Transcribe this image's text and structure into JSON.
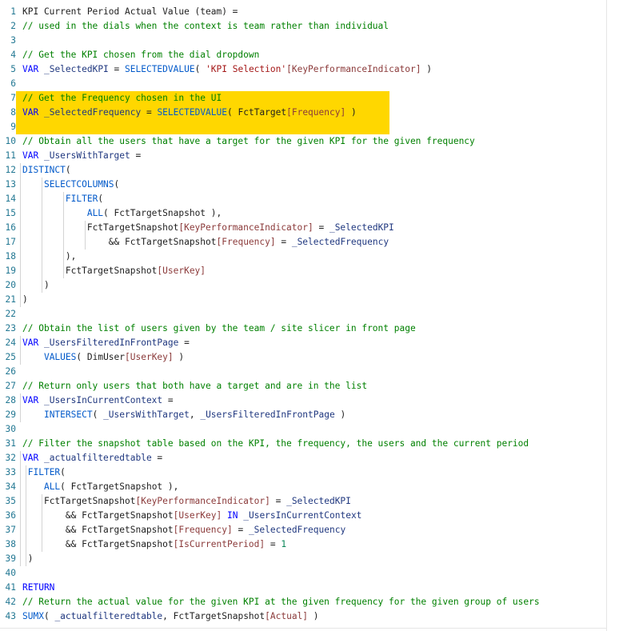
{
  "editor": {
    "highlight_color": "#ffd700",
    "lines": [
      {
        "n": "1",
        "tokens": [
          [
            "plain",
            "KPI Current Period Actual Value (team) ="
          ]
        ]
      },
      {
        "n": "2",
        "tokens": [
          [
            "com",
            "// used in the dials when the context is team rather than individual"
          ]
        ]
      },
      {
        "n": "3",
        "tokens": []
      },
      {
        "n": "4",
        "tokens": [
          [
            "com",
            "// Get the KPI chosen from the dial dropdown"
          ]
        ]
      },
      {
        "n": "5",
        "tokens": [
          [
            "kw",
            "VAR"
          ],
          [
            "plain",
            " "
          ],
          [
            "var",
            "_SelectedKPI"
          ],
          [
            "op",
            " = "
          ],
          [
            "fn",
            "SELECTEDVALUE"
          ],
          [
            "op",
            "( "
          ],
          [
            "str",
            "'KPI Selection'"
          ],
          [
            "col",
            "[KeyPerformanceIndicator]"
          ],
          [
            "op",
            " )"
          ]
        ]
      },
      {
        "n": "6",
        "tokens": []
      },
      {
        "n": "7",
        "hl": true,
        "tokens": [
          [
            "com",
            "// Get the Frequency chosen in the UI"
          ]
        ]
      },
      {
        "n": "8",
        "hl": true,
        "tokens": [
          [
            "kw",
            "VAR"
          ],
          [
            "plain",
            " "
          ],
          [
            "var",
            "_SelectedFrequency"
          ],
          [
            "op",
            " = "
          ],
          [
            "fn",
            "SELECTEDVALUE"
          ],
          [
            "op",
            "( "
          ],
          [
            "tbl",
            "FctTarget"
          ],
          [
            "col",
            "[Frequency]"
          ],
          [
            "op",
            " )"
          ]
        ]
      },
      {
        "n": "9",
        "hl": true,
        "tokens": []
      },
      {
        "n": "10",
        "tokens": [
          [
            "com",
            "// Obtain all the users that have a target for the given KPI for the given frequency"
          ]
        ]
      },
      {
        "n": "11",
        "tokens": [
          [
            "kw",
            "VAR"
          ],
          [
            "plain",
            " "
          ],
          [
            "var",
            "_UsersWithTarget"
          ],
          [
            "op",
            " ="
          ]
        ]
      },
      {
        "n": "12",
        "tokens": [
          [
            "fn",
            "DISTINCT"
          ],
          [
            "op",
            "("
          ]
        ]
      },
      {
        "n": "13",
        "tokens": [
          [
            "plain",
            "    "
          ],
          [
            "fn",
            "SELECTCOLUMNS"
          ],
          [
            "op",
            "("
          ]
        ]
      },
      {
        "n": "14",
        "tokens": [
          [
            "plain",
            "        "
          ],
          [
            "fn",
            "FILTER"
          ],
          [
            "op",
            "("
          ]
        ]
      },
      {
        "n": "15",
        "tokens": [
          [
            "plain",
            "            "
          ],
          [
            "fn",
            "ALL"
          ],
          [
            "op",
            "( "
          ],
          [
            "tbl",
            "FctTargetSnapshot"
          ],
          [
            "op",
            " ),"
          ]
        ]
      },
      {
        "n": "16",
        "tokens": [
          [
            "plain",
            "            "
          ],
          [
            "tbl",
            "FctTargetSnapshot"
          ],
          [
            "col",
            "[KeyPerformanceIndicator]"
          ],
          [
            "op",
            " = "
          ],
          [
            "var",
            "_SelectedKPI"
          ]
        ]
      },
      {
        "n": "17",
        "tokens": [
          [
            "plain",
            "                "
          ],
          [
            "op",
            "&& "
          ],
          [
            "tbl",
            "FctTargetSnapshot"
          ],
          [
            "col",
            "[Frequency]"
          ],
          [
            "op",
            " = "
          ],
          [
            "var",
            "_SelectedFrequency"
          ]
        ]
      },
      {
        "n": "18",
        "tokens": [
          [
            "plain",
            "        "
          ],
          [
            "op",
            "),"
          ]
        ]
      },
      {
        "n": "19",
        "tokens": [
          [
            "plain",
            "        "
          ],
          [
            "tbl",
            "FctTargetSnapshot"
          ],
          [
            "col",
            "[UserKey]"
          ]
        ]
      },
      {
        "n": "20",
        "tokens": [
          [
            "plain",
            "    "
          ],
          [
            "op",
            ")"
          ]
        ]
      },
      {
        "n": "21",
        "tokens": [
          [
            "op",
            ")"
          ]
        ]
      },
      {
        "n": "22",
        "tokens": []
      },
      {
        "n": "23",
        "tokens": [
          [
            "com",
            "// Obtain the list of users given by the team / site slicer in front page"
          ]
        ]
      },
      {
        "n": "24",
        "tokens": [
          [
            "kw",
            "VAR"
          ],
          [
            "plain",
            " "
          ],
          [
            "var",
            "_UsersFilteredInFrontPage"
          ],
          [
            "op",
            " ="
          ]
        ]
      },
      {
        "n": "25",
        "tokens": [
          [
            "plain",
            "    "
          ],
          [
            "fn",
            "VALUES"
          ],
          [
            "op",
            "( "
          ],
          [
            "tbl",
            "DimUser"
          ],
          [
            "col",
            "[UserKey]"
          ],
          [
            "op",
            " )"
          ]
        ]
      },
      {
        "n": "26",
        "tokens": []
      },
      {
        "n": "27",
        "tokens": [
          [
            "com",
            "// Return only users that both have a target and are in the list"
          ]
        ]
      },
      {
        "n": "28",
        "tokens": [
          [
            "kw",
            "VAR"
          ],
          [
            "plain",
            " "
          ],
          [
            "var",
            "_UsersInCurrentContext"
          ],
          [
            "op",
            " ="
          ]
        ]
      },
      {
        "n": "29",
        "tokens": [
          [
            "plain",
            "    "
          ],
          [
            "fn",
            "INTERSECT"
          ],
          [
            "op",
            "( "
          ],
          [
            "var",
            "_UsersWithTarget"
          ],
          [
            "op",
            ", "
          ],
          [
            "var",
            "_UsersFilteredInFrontPage"
          ],
          [
            "op",
            " )"
          ]
        ]
      },
      {
        "n": "30",
        "tokens": []
      },
      {
        "n": "31",
        "tokens": [
          [
            "com",
            "// Filter the snapshot table based on the KPI, the frequency, the users and the current period"
          ]
        ]
      },
      {
        "n": "32",
        "tokens": [
          [
            "kw",
            "VAR"
          ],
          [
            "plain",
            " "
          ],
          [
            "var",
            "_actualfilteredtable"
          ],
          [
            "op",
            " ="
          ]
        ]
      },
      {
        "n": "33",
        "tokens": [
          [
            "plain",
            " "
          ],
          [
            "fn",
            "FILTER"
          ],
          [
            "op",
            "("
          ]
        ]
      },
      {
        "n": "34",
        "tokens": [
          [
            "plain",
            "    "
          ],
          [
            "fn",
            "ALL"
          ],
          [
            "op",
            "( "
          ],
          [
            "tbl",
            "FctTargetSnapshot"
          ],
          [
            "op",
            " ),"
          ]
        ]
      },
      {
        "n": "35",
        "tokens": [
          [
            "plain",
            "    "
          ],
          [
            "tbl",
            "FctTargetSnapshot"
          ],
          [
            "col",
            "[KeyPerformanceIndicator]"
          ],
          [
            "op",
            " = "
          ],
          [
            "var",
            "_SelectedKPI"
          ]
        ]
      },
      {
        "n": "36",
        "tokens": [
          [
            "plain",
            "        "
          ],
          [
            "op",
            "&& "
          ],
          [
            "tbl",
            "FctTargetSnapshot"
          ],
          [
            "col",
            "[UserKey]"
          ],
          [
            "plain",
            " "
          ],
          [
            "kw",
            "IN"
          ],
          [
            "plain",
            " "
          ],
          [
            "var",
            "_UsersInCurrentContext"
          ]
        ]
      },
      {
        "n": "37",
        "tokens": [
          [
            "plain",
            "        "
          ],
          [
            "op",
            "&& "
          ],
          [
            "tbl",
            "FctTargetSnapshot"
          ],
          [
            "col",
            "[Frequency]"
          ],
          [
            "op",
            " = "
          ],
          [
            "var",
            "_SelectedFrequency"
          ]
        ]
      },
      {
        "n": "38",
        "tokens": [
          [
            "plain",
            "        "
          ],
          [
            "op",
            "&& "
          ],
          [
            "tbl",
            "FctTargetSnapshot"
          ],
          [
            "col",
            "[IsCurrentPeriod]"
          ],
          [
            "op",
            " = "
          ],
          [
            "num",
            "1"
          ]
        ]
      },
      {
        "n": "39",
        "tokens": [
          [
            "plain",
            " "
          ],
          [
            "op",
            ")"
          ]
        ]
      },
      {
        "n": "40",
        "tokens": []
      },
      {
        "n": "41",
        "tokens": [
          [
            "kw",
            "RETURN"
          ]
        ]
      },
      {
        "n": "42",
        "tokens": [
          [
            "com",
            "// Return the actual value for the given KPI at the given frequency for the given group of users"
          ]
        ]
      },
      {
        "n": "43",
        "tokens": [
          [
            "fn",
            "SUMX"
          ],
          [
            "op",
            "( "
          ],
          [
            "var",
            "_actualfilteredtable"
          ],
          [
            "op",
            ", "
          ],
          [
            "tbl",
            "FctTargetSnapshot"
          ],
          [
            "col",
            "[Actual]"
          ],
          [
            "op",
            " )"
          ]
        ]
      }
    ]
  }
}
